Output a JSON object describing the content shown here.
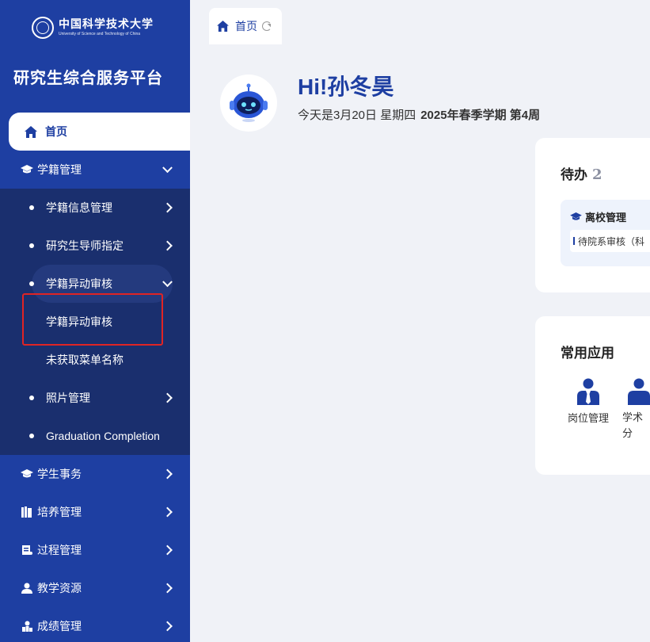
{
  "logo": {
    "cn": "中国科学技术大学",
    "en": "University of Science and Technology of China"
  },
  "platform_title": "研究生综合服务平台",
  "sidebar": {
    "home": "首页",
    "xueji": "学籍管理",
    "sub": {
      "info": "学籍信息管理",
      "mentor": "研究生导师指定",
      "change": "学籍异动审核",
      "change_child": "学籍异动审核",
      "unnamed": "未获取菜单名称",
      "photo": "照片管理",
      "graduation": "Graduation Completion"
    },
    "student_affairs": "学生事务",
    "training": "培养管理",
    "process": "过程管理",
    "teaching": "教学资源",
    "grades": "成绩管理"
  },
  "tabs": {
    "home": "首页"
  },
  "main": {
    "greeting": "Hi!孙冬昊",
    "date_prefix": "今天是3月20日 星期四",
    "term": "2025年春季学期 第4周",
    "todo": {
      "title": "待办",
      "count": "2",
      "group": "离校管理",
      "item": "待院系审核（科"
    },
    "apps": {
      "title": "常用应用",
      "items": [
        "岗位管理",
        "学术分"
      ]
    }
  },
  "colors": {
    "primary": "#1e3fa2",
    "submenu_bg": "#1a2f6e",
    "highlight_border": "#e02424"
  }
}
